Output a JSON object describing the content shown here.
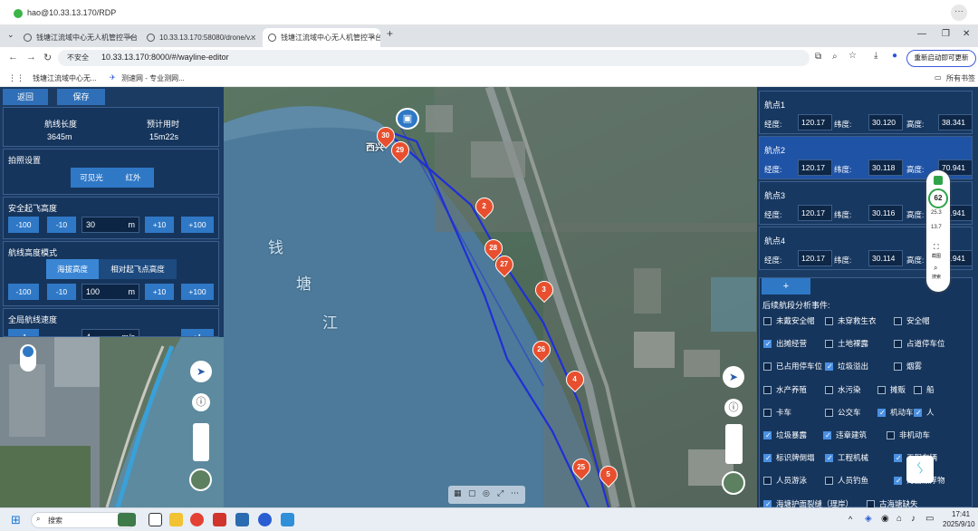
{
  "rdp": {
    "title": "hao@10.33.13.170/RDP",
    "more": "···"
  },
  "tabs": [
    {
      "label": "钱塘江流域中心无人机管控平台"
    },
    {
      "label": "10.33.13.170:58080/drone/v..."
    },
    {
      "label": "钱塘江流域中心无人机管控平台"
    }
  ],
  "address": {
    "insecure": "不安全",
    "url": "10.33.13.170:8000/#/wayline-editor",
    "update": "重新启动即可更新"
  },
  "bookmarks": [
    {
      "label": "钱塘江流域中心无..."
    },
    {
      "label": "测速网 - 专业测网..."
    }
  ],
  "bookmarks_all": "所有书签",
  "left": {
    "back": "返回",
    "save": "保存",
    "route_length_label": "航线长度",
    "route_length": "3645m",
    "est_time_label": "预计用时",
    "est_time": "15m22s",
    "photo_settings": "拍照设置",
    "visible": "可见光",
    "infrared": "红外",
    "takeoff_height": "安全起飞高度",
    "m100": "-100",
    "m10": "-10",
    "takeoff_value": "30",
    "unit_m": "m",
    "p10": "+10",
    "p100": "+100",
    "height_mode": "航线高度模式",
    "alt_sea": "海拔高度",
    "alt_rel": "相对起飞点高度",
    "height_value": "100",
    "speed": "全局航线速度",
    "speed_value": "4",
    "speed_unit": "m/s",
    "speed_m1": "-1",
    "speed_p1": "+1"
  },
  "waypoints": [
    {
      "name": "航点1",
      "lng_label": "经度:",
      "lng": "120.17",
      "lat_label": "纬度:",
      "lat": "30.120",
      "alt_label": "高度:",
      "alt": "38.341"
    },
    {
      "name": "航点2",
      "lng_label": "经度:",
      "lng": "120.17",
      "lat_label": "纬度:",
      "lat": "30.118",
      "alt_label": "高度:",
      "alt": "70.941"
    },
    {
      "name": "航点3",
      "lng_label": "经度:",
      "lng": "120.17",
      "lat_label": "纬度:",
      "lat": "30.116",
      "alt_label": "高度:",
      "alt": "70.941"
    },
    {
      "name": "航点4",
      "lng_label": "经度:",
      "lng": "120.17",
      "lat_label": "纬度:",
      "lat": "30.114",
      "alt_label": "高度:",
      "alt": "70.941"
    }
  ],
  "add_button": "+",
  "events_title": "后续航段分析事件:",
  "events": [
    {
      "label": "未戴安全帽",
      "on": false
    },
    {
      "label": "未穿救生衣",
      "on": false
    },
    {
      "label": "安全帽",
      "on": false
    },
    {
      "label": "出摊经营",
      "on": true
    },
    {
      "label": "土地裸露",
      "on": false
    },
    {
      "label": "占道停车位",
      "on": false
    },
    {
      "label": "已占用停车位",
      "on": false
    },
    {
      "label": "垃圾溢出",
      "on": true
    },
    {
      "label": "烟雾",
      "on": false
    },
    {
      "label": "水产养殖",
      "on": false
    },
    {
      "label": "水污染",
      "on": false
    },
    {
      "label": "摊贩",
      "on": false
    },
    {
      "label": "船",
      "on": false
    },
    {
      "label": "卡车",
      "on": false
    },
    {
      "label": "公交车",
      "on": false
    },
    {
      "label": "机动车",
      "on": true
    },
    {
      "label": "人",
      "on": true
    },
    {
      "label": "垃圾暴露",
      "on": true
    },
    {
      "label": "违章建筑",
      "on": true
    },
    {
      "label": "非机动车",
      "on": false
    },
    {
      "label": "标识牌倒塌",
      "on": true
    },
    {
      "label": "工程机械",
      "on": true
    },
    {
      "label": "工程车辆",
      "on": true
    },
    {
      "label": "人员游泳",
      "on": false
    },
    {
      "label": "人员钓鱼",
      "on": false
    },
    {
      "label": "河面漂浮物",
      "on": true
    },
    {
      "label": "海塘护面裂缝（理岸）",
      "on": true
    },
    {
      "label": "古海塘缺失",
      "on": false
    }
  ],
  "map": {
    "river_chars": [
      "钱",
      "塘",
      "江"
    ],
    "place": "西兴",
    "markers": [
      "30",
      "29",
      "2",
      "28",
      "27",
      "3",
      "26",
      "4",
      "25",
      "5"
    ],
    "bottom_tools": [
      "▦",
      "▢",
      "◎",
      "⤢",
      "⋯"
    ]
  },
  "net": {
    "pct": "62",
    "up": "25.3",
    "down": "13.7",
    "b1": "截图",
    "b2": "搜索"
  },
  "taskbar": {
    "search": "搜索",
    "time": "17:41",
    "date": "2025/9/10"
  },
  "colors": {
    "panel": "#1b3b63",
    "accent": "#2f78c6",
    "marker": "#e84f2e",
    "route": "#1f2fd8"
  }
}
